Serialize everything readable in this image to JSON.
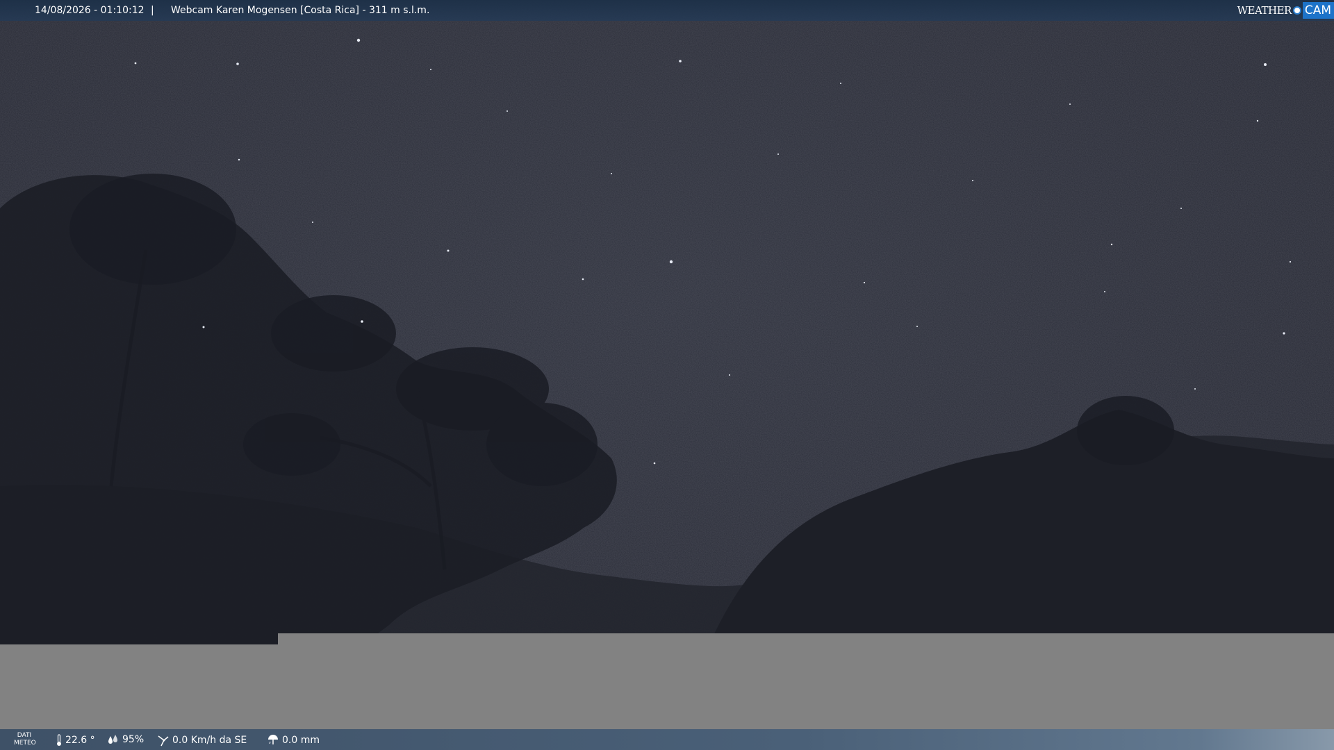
{
  "header": {
    "datetime": "14/08/2026 - 01:10:12",
    "separator": "|",
    "title": "Webcam Karen Mogensen [Costa Rica] - 311 m s.l.m.",
    "brand_weather": "WEATHER",
    "brand_cam": "CAM"
  },
  "footer": {
    "label_line1": "DATI",
    "label_line2": "METEO",
    "temperature": "22.6 °",
    "humidity": "95%",
    "wind": "0.0 Km/h da SE",
    "rain": "0.0 mm"
  },
  "colors": {
    "sky": "#2a2d38",
    "header_bg": "#1c3048",
    "footer_bg": "#4a6078",
    "gray_panel": "#828282",
    "brand_blue": "#1d73c9"
  },
  "icons": [
    "thermometer-icon",
    "humidity-drop-icon",
    "wind-icon",
    "rain-gauge-icon"
  ]
}
